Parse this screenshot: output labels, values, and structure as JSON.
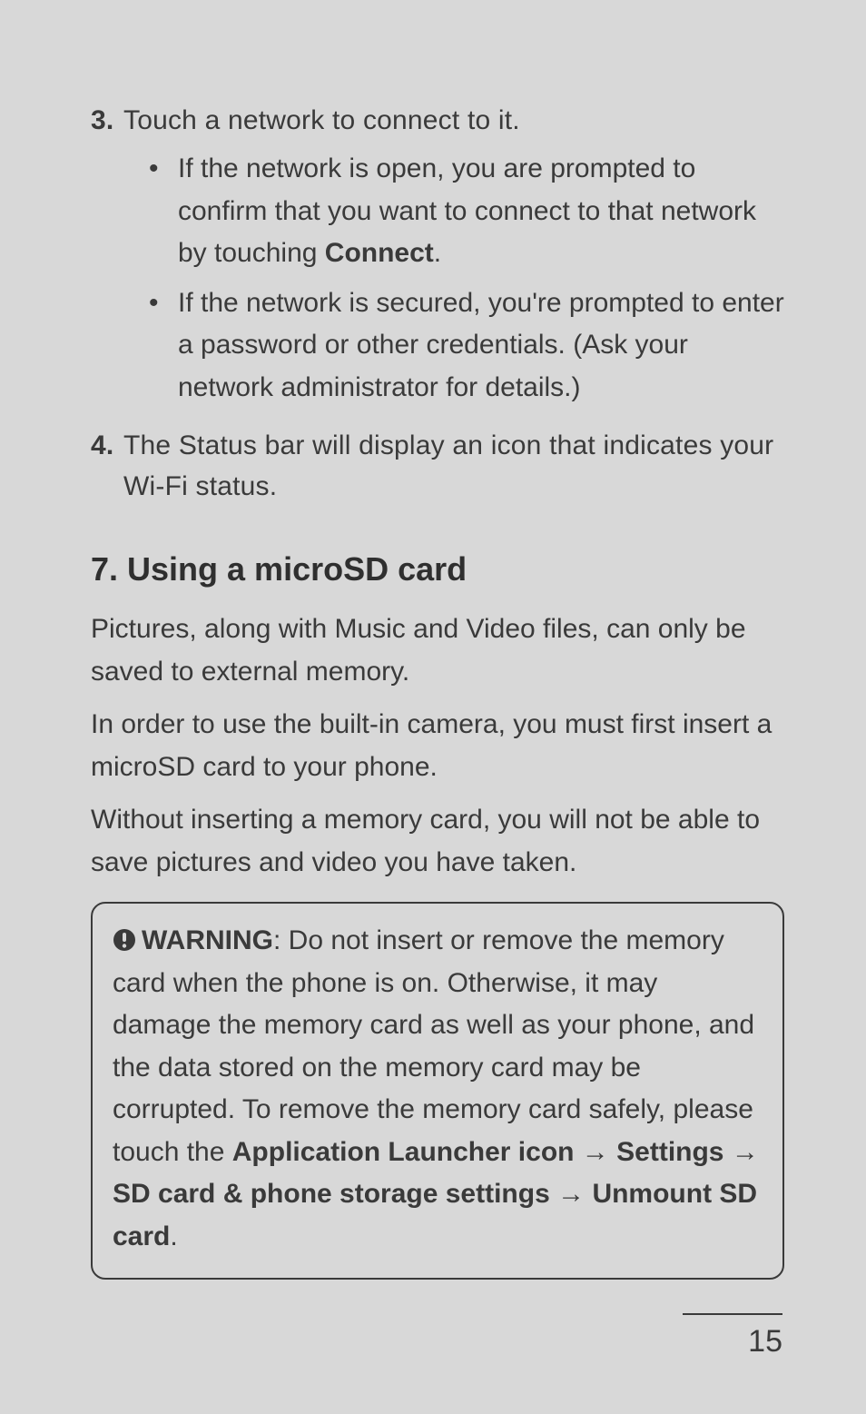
{
  "steps": {
    "s3": {
      "num": "3.",
      "text": "Touch a network to connect to it.",
      "bullets": {
        "b1_pre": "If the network is open, you are prompted to confirm that you want to connect to that network by touching ",
        "b1_bold": "Connect",
        "b1_post": ".",
        "b2": "If the network is secured, you're prompted to enter a password or other credentials. (Ask your network administrator for details.)"
      }
    },
    "s4": {
      "num": "4.",
      "text": "The Status bar will display an icon that indicates your Wi-Fi status."
    }
  },
  "section": {
    "heading": "7. Using a microSD card",
    "p1": "Pictures, along with Music and Video files, can only be saved to external memory.",
    "p2": "In order to use the built-in camera, you must first insert a microSD card to your phone.",
    "p3": "Without inserting a memory card, you will not be able to save pictures and video you have taken."
  },
  "warning": {
    "title": "WARNING",
    "body_pre": ": Do not insert or remove the memory card when the phone is on. Otherwise, it may damage the memory card as well as your phone, and the data stored on the memory card may be corrupted. To remove the memory card safely, please touch the ",
    "path1": "Application Launcher icon",
    "arrow": " → ",
    "path2": "Settings",
    "path3": "SD card & phone storage settings",
    "path4": "Unmount SD card",
    "period": "."
  },
  "page_number": "15"
}
